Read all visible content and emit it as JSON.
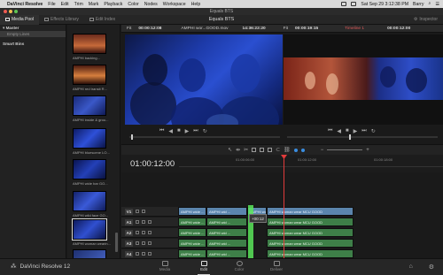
{
  "menubar": {
    "app": "DaVinci Resolve",
    "items": [
      "File",
      "Edit",
      "Trim",
      "Mark",
      "Playback",
      "Color",
      "Nodes",
      "Workspace",
      "Help"
    ],
    "clock": "Sat Sep 29  3:12:38 PM",
    "user": "Barry"
  },
  "window": {
    "title": "Equals BTS"
  },
  "toolbar": {
    "tabs": [
      {
        "label": "Media Pool",
        "icon": "media-pool-icon",
        "active": true
      },
      {
        "label": "Effects Library",
        "icon": "effects-icon",
        "active": false
      },
      {
        "label": "Edit Index",
        "icon": "edit-index-icon",
        "active": false
      }
    ],
    "project_name": "Equals BTS",
    "inspector_label": "Inspector"
  },
  "bins": {
    "master": "Master",
    "master_child": "Empty Lines",
    "smart_bins": "Smart Bins"
  },
  "media_pool": {
    "clips": [
      "AMPHI backing...",
      "AMPHI red transit R...",
      "AMPHI inside & grou...",
      "AMPHI bluescene LO...",
      "AMPHI wide bar GO...",
      "AMPHI wild face GO...",
      "AMPHI woman wearin...",
      "Timeline 1"
    ]
  },
  "source_viewer": {
    "zoom": "Fit",
    "duration": "00:00:12:08",
    "clip": "AMPHI wor...GOOD.mov",
    "timecode": "14:36:22:20"
  },
  "timeline_viewer": {
    "zoom": "Fit",
    "duration": "00:00:19:15",
    "timeline_name": "Timeline 1",
    "timecode": "00:00:12:00"
  },
  "timeline": {
    "current_timecode": "01:00:12:00",
    "ruler_labels": [
      "01:00:06:00",
      "01:00:12:00",
      "01:00:18:00"
    ],
    "tracks": [
      {
        "id": "V1",
        "clips": [
          "AMPHI wide ...",
          "AMPHI wid ...",
          "AMPHI woman wearing ...",
          "AMPHI woman wear MCU GOOD"
        ]
      },
      {
        "id": "A1",
        "clips": [
          "AMPHI wide ...",
          "AMPHI wid ...",
          "AMPHI woman wear MCU GOOD"
        ]
      },
      {
        "id": "A2",
        "clips": [
          "AMPHI wide ...",
          "AMPHI wid ...",
          "AMPHI woman wear MCU GOOD"
        ]
      },
      {
        "id": "A3",
        "clips": [
          "AMPHI wide ...",
          "AMPHI wid ...",
          "AMPHI woman wear MCU GOOD"
        ]
      },
      {
        "id": "A4",
        "clips": [
          "AMPHI wide ...",
          "AMPHI wid ...",
          "AMPHI woman wear MCU GOOD"
        ]
      }
    ],
    "trim_tooltip": "+00:12"
  },
  "pages": [
    {
      "label": "Media",
      "icon": "media-page-icon",
      "active": false
    },
    {
      "label": "Edit",
      "icon": "edit-page-icon",
      "active": true
    },
    {
      "label": "Color",
      "icon": "color-page-icon",
      "active": false
    },
    {
      "label": "Deliver",
      "icon": "deliver-page-icon",
      "active": false
    }
  ],
  "brand": {
    "name": "DaVinci Resolve 12"
  },
  "colors": {
    "playhead": "#e23b3b",
    "video_clip": "#5b85ad",
    "audio_clip": "#3e7f48",
    "trim_highlight": "#5ae65a"
  }
}
